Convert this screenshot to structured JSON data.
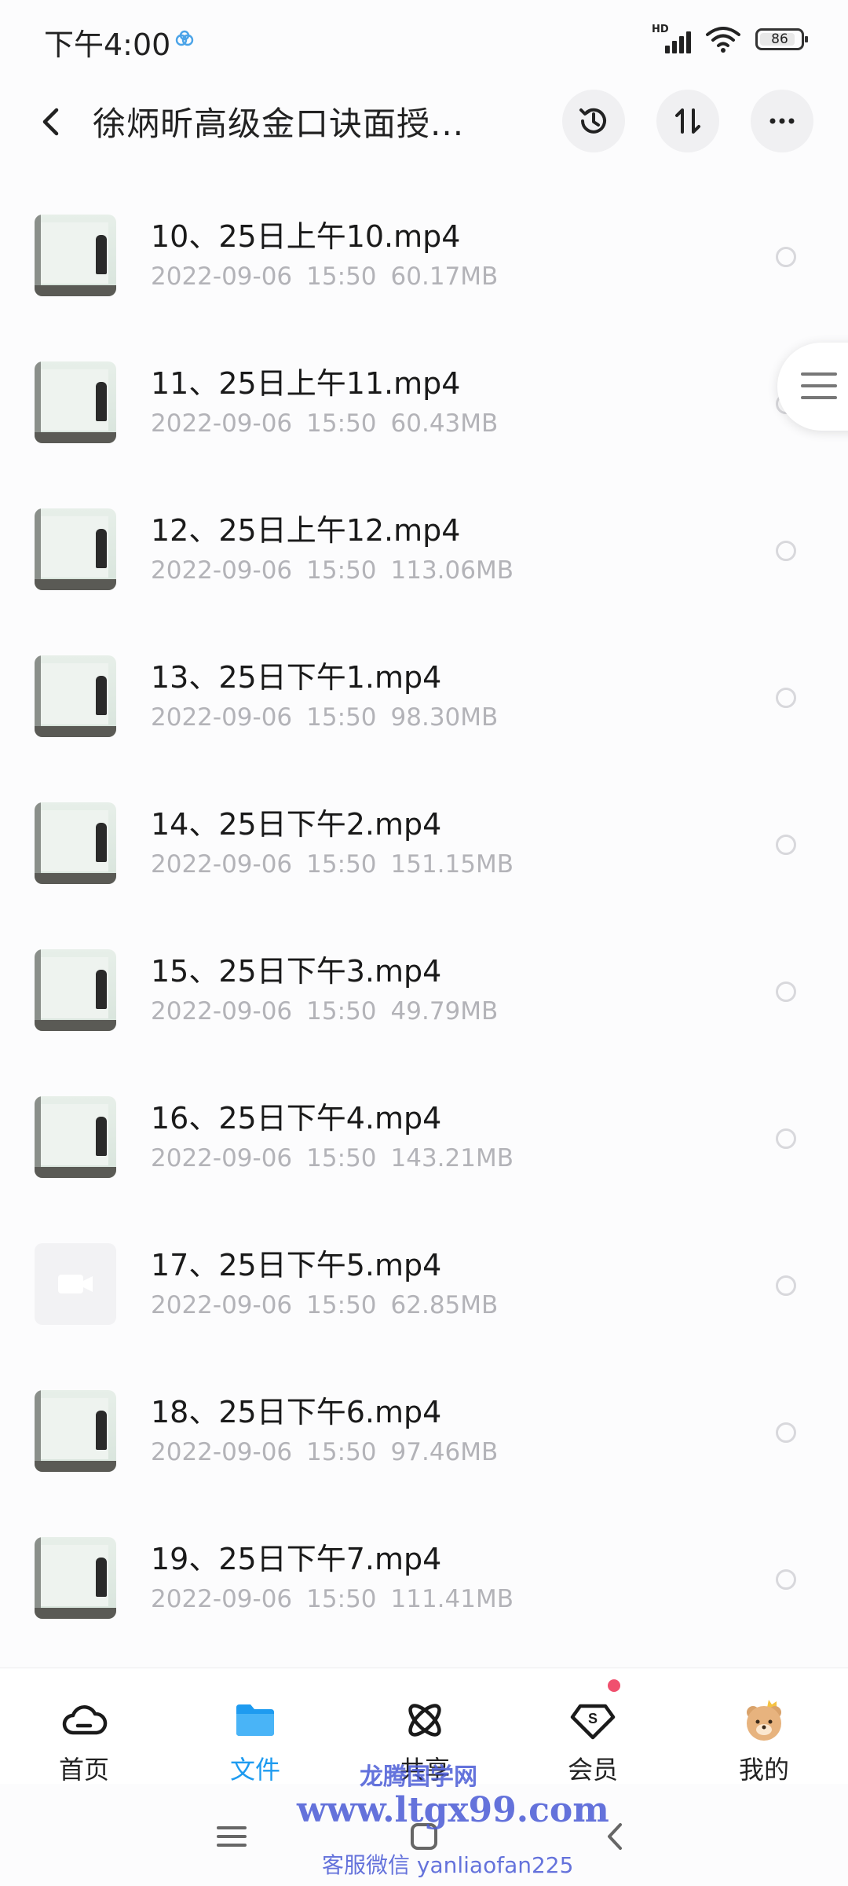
{
  "status_bar": {
    "time": "下午4:00",
    "network_label": "HD",
    "battery": "86"
  },
  "header": {
    "title": "徐炳昕高级金口诀面授..."
  },
  "files": [
    {
      "name": "10、25日上午10.mp4",
      "date": "2022-09-06",
      "time": "15:50",
      "size": "60.17MB",
      "thumb": "video"
    },
    {
      "name": "11、25日上午11.mp4",
      "date": "2022-09-06",
      "time": "15:50",
      "size": "60.43MB",
      "thumb": "video"
    },
    {
      "name": "12、25日上午12.mp4",
      "date": "2022-09-06",
      "time": "15:50",
      "size": "113.06MB",
      "thumb": "video"
    },
    {
      "name": "13、25日下午1.mp4",
      "date": "2022-09-06",
      "time": "15:50",
      "size": "98.30MB",
      "thumb": "video"
    },
    {
      "name": "14、25日下午2.mp4",
      "date": "2022-09-06",
      "time": "15:50",
      "size": "151.15MB",
      "thumb": "video"
    },
    {
      "name": "15、25日下午3.mp4",
      "date": "2022-09-06",
      "time": "15:50",
      "size": "49.79MB",
      "thumb": "video"
    },
    {
      "name": "16、25日下午4.mp4",
      "date": "2022-09-06",
      "time": "15:50",
      "size": "143.21MB",
      "thumb": "video"
    },
    {
      "name": "17、25日下午5.mp4",
      "date": "2022-09-06",
      "time": "15:50",
      "size": "62.85MB",
      "thumb": "placeholder"
    },
    {
      "name": "18、25日下午6.mp4",
      "date": "2022-09-06",
      "time": "15:50",
      "size": "97.46MB",
      "thumb": "video"
    },
    {
      "name": "19、25日下午7.mp4",
      "date": "2022-09-06",
      "time": "15:50",
      "size": "111.41MB",
      "thumb": "video"
    }
  ],
  "bottom_nav": {
    "items": [
      {
        "label": "首页",
        "icon": "cloud-home-icon",
        "active": false
      },
      {
        "label": "文件",
        "icon": "folder-icon",
        "active": true
      },
      {
        "label": "共享",
        "icon": "share-orbit-icon",
        "active": false
      },
      {
        "label": "会员",
        "icon": "vip-diamond-icon",
        "active": false,
        "badge": true
      },
      {
        "label": "我的",
        "icon": "bear-avatar-icon",
        "active": false
      }
    ]
  },
  "watermark": {
    "site_name": "龙腾国学网",
    "url": "www.ltgx99.com",
    "contact": "客服微信 yanliaofan225"
  },
  "colors": {
    "accent": "#1e9bf0",
    "badge": "#f0506e",
    "meta_text": "#b3b3b8",
    "watermark": "#4a5bd6"
  }
}
